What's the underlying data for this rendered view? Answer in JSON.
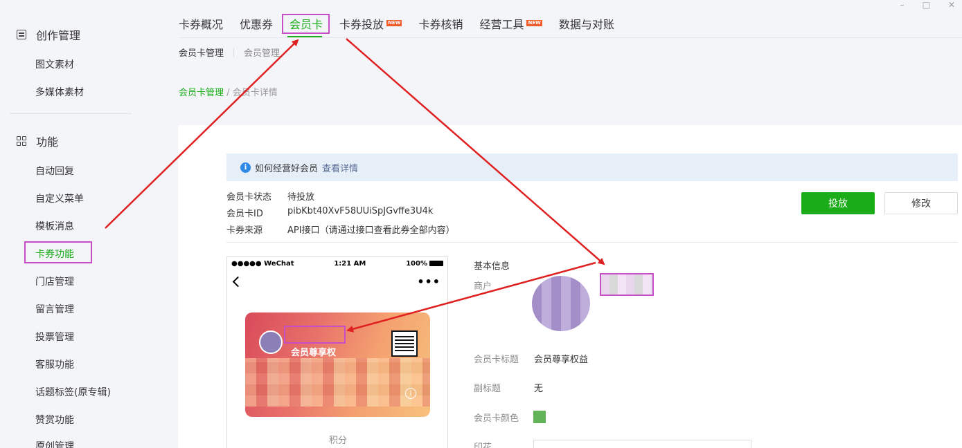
{
  "window_controls": [
    "–",
    "□",
    "✕"
  ],
  "sidebar": {
    "sections": [
      {
        "title": "创作管理",
        "icon": "document-icon",
        "items": [
          "图文素材",
          "多媒体素材"
        ]
      },
      {
        "title": "功能",
        "icon": "grid-icon",
        "items": [
          "自动回复",
          "自定义菜单",
          "模板消息",
          "卡券功能",
          "门店管理",
          "留言管理",
          "投票管理",
          "客服功能",
          "话题标签(原专辑)",
          "赞赏功能",
          "原创管理"
        ]
      }
    ],
    "active_item": "卡券功能"
  },
  "topnav": {
    "tabs": [
      {
        "label": "卡券概况"
      },
      {
        "label": "优惠券"
      },
      {
        "label": "会员卡",
        "active": true
      },
      {
        "label": "卡券投放",
        "badge": "NEW"
      },
      {
        "label": "卡券核销"
      },
      {
        "label": "经营工具",
        "badge": "NEW"
      },
      {
        "label": "数据与对账"
      }
    ]
  },
  "subnav": {
    "items": [
      "会员卡管理",
      "会员管理"
    ]
  },
  "breadcrumb": {
    "link": "会员卡管理",
    "separator": "/",
    "current": "会员卡详情"
  },
  "notice": {
    "text": "如何经营好会员",
    "link": "查看详情"
  },
  "card_meta": [
    {
      "label": "会员卡状态",
      "value": "待投放"
    },
    {
      "label": "会员卡ID",
      "value": "pibKbt40XvF58UUiSpJGvffe3U4k"
    },
    {
      "label": "卡券来源",
      "value": "API接口（请通过接口查看此券全部内容）"
    }
  ],
  "actions": {
    "primary": "投放",
    "secondary": "修改"
  },
  "phone": {
    "carrier": "●●●●● WeChat",
    "time": "1:21 AM",
    "battery": "100%",
    "card_title": "会员尊享权",
    "points_label": "积分"
  },
  "detail": {
    "section_title": "基本信息",
    "merchant_label": "商户",
    "fields": [
      {
        "label": "会员卡标题",
        "value": "会员尊享权益"
      },
      {
        "label": "副标题",
        "value": "无"
      },
      {
        "label": "会员卡颜色",
        "value": ""
      },
      {
        "label": "印花",
        "value": ""
      }
    ],
    "card_color": "#63b359"
  },
  "colors": {
    "accent": "#1aad19",
    "highlight_box": "#c64fc6",
    "annotation_arrow": "#e02020"
  }
}
